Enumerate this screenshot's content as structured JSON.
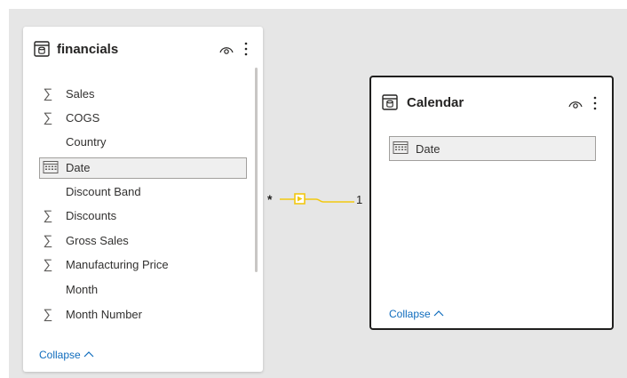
{
  "colors": {
    "canvas_bg": "#e6e6e6",
    "card_bg": "#ffffff",
    "relationship_line": "#f2c811",
    "link": "#0f6cbd",
    "selected_border": "#a19f9d"
  },
  "financials": {
    "title": "financials",
    "collapse_label": "Collapse",
    "fields": [
      {
        "label": "Sales",
        "icon": "sigma-icon"
      },
      {
        "label": "COGS",
        "icon": "sigma-icon"
      },
      {
        "label": "Country",
        "icon": ""
      },
      {
        "label": "Date",
        "icon": "calendar-icon",
        "selected": true
      },
      {
        "label": "Discount Band",
        "icon": ""
      },
      {
        "label": "Discounts",
        "icon": "sigma-icon"
      },
      {
        "label": "Gross Sales",
        "icon": "sigma-icon"
      },
      {
        "label": "Manufacturing Price",
        "icon": "sigma-icon"
      },
      {
        "label": "Month",
        "icon": ""
      },
      {
        "label": "Month Number",
        "icon": "sigma-icon"
      }
    ]
  },
  "calendar": {
    "title": "Calendar",
    "collapse_label": "Collapse",
    "fields": [
      {
        "label": "Date",
        "icon": "calendar-icon",
        "selected": true
      }
    ]
  },
  "relationship": {
    "from_cardinality": "*",
    "to_cardinality": "1"
  }
}
